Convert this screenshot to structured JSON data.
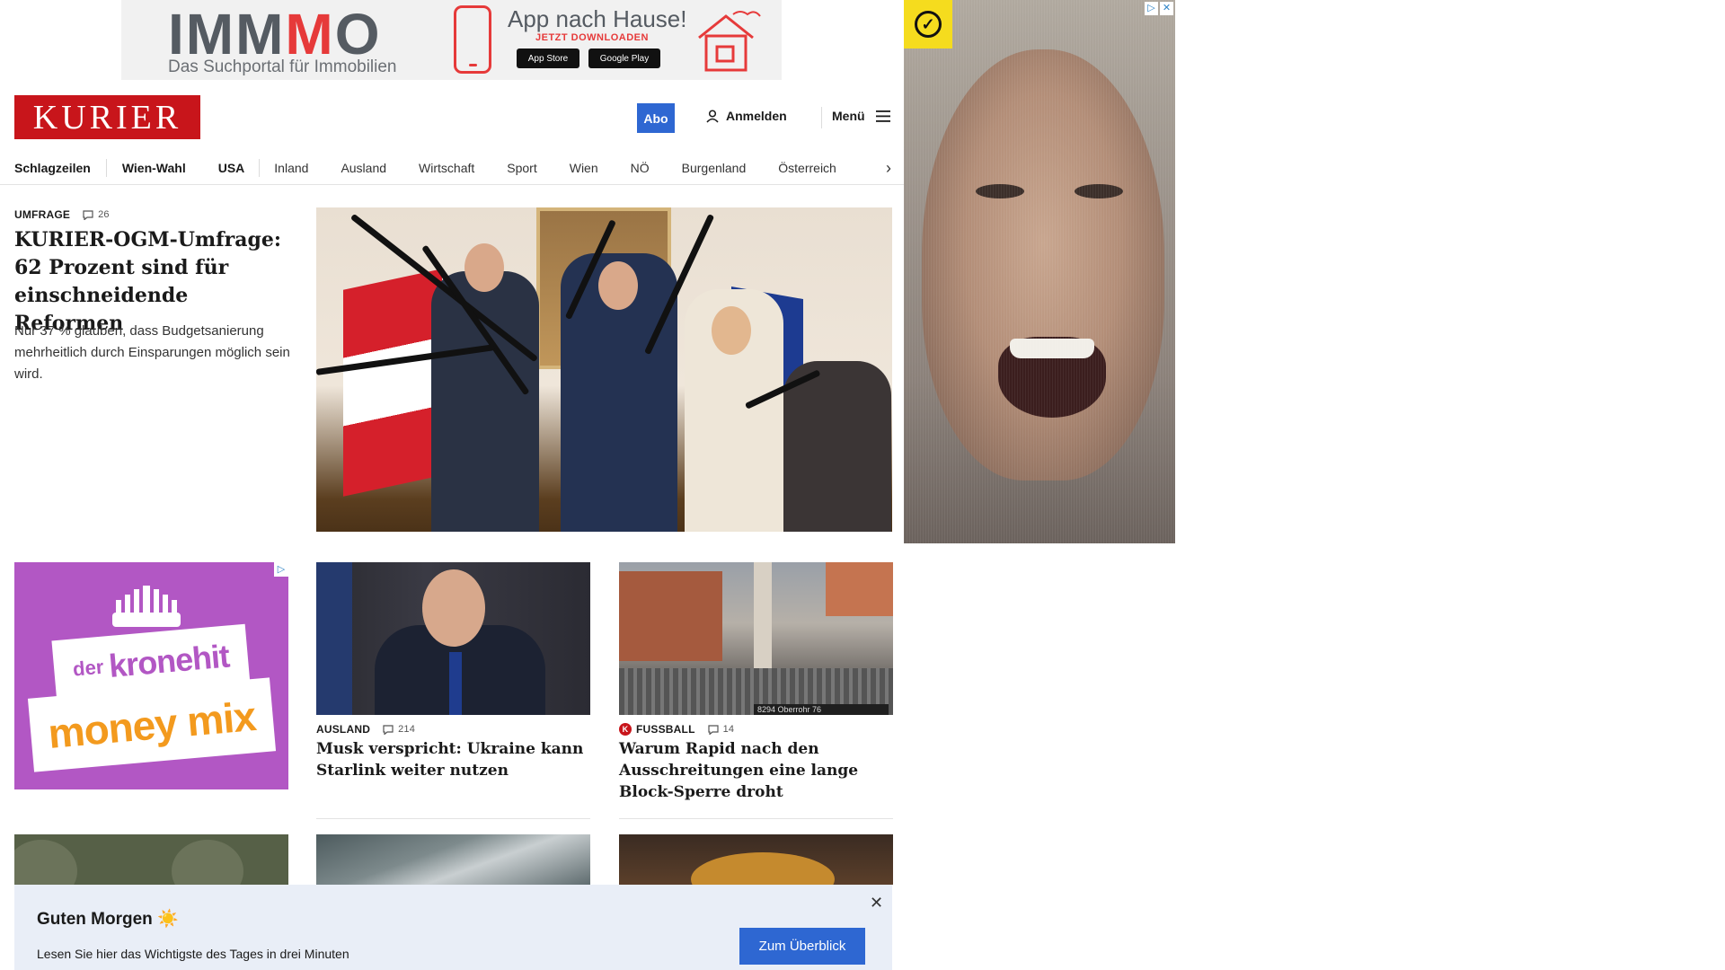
{
  "top_ad": {
    "logo_a": "IMM",
    "logo_red": "M",
    "logo_b": "O",
    "tagline": "Das Suchportal für Immobilien",
    "headline": "App nach Hause!",
    "sub": "JETZT DOWNLOADEN",
    "app_store": "App Store",
    "google_play": "Google Play"
  },
  "side_ad": {
    "corner_icons": [
      "ad-choices-icon",
      "close-icon"
    ]
  },
  "header": {
    "logo": "KURIER",
    "abo": "Abo",
    "login": "Anmelden",
    "menu": "Menü"
  },
  "nav": {
    "items": [
      "Schlagzeilen",
      "Wien-Wahl",
      "USA",
      "Inland",
      "Ausland",
      "Wirtschaft",
      "Sport",
      "Wien",
      "NÖ",
      "Burgenland",
      "Österreich"
    ]
  },
  "lead": {
    "kicker": "UMFRAGE",
    "comments": "26",
    "title": "KURIER-OGM-Umfrage: 62 Prozent sind für einschneidende Reformen",
    "teaser": "Nur 37 % glauben, dass Budgetsanierung mehrheitlich durch Einsparungen möglich sein wird."
  },
  "kronehit_ad": {
    "der": "der",
    "brand": "kronehit",
    "slogan": "money mix"
  },
  "teasers": [
    {
      "kicker": "AUSLAND",
      "comments": "214",
      "title": "Musk verspricht: Ukraine kann Starlink weiter nutzen"
    },
    {
      "kicker": "FUSSBALL",
      "comments": "14",
      "title": "Warum Rapid nach den Ausschreitungen eine lange Block-Sperre droht",
      "image_sign": "8294 Oberrohr 76"
    }
  ],
  "greeting": {
    "title": "Guten Morgen ☀️",
    "text": "Lesen Sie hier das Wichtigste des Tages in drei Minuten",
    "button": "Zum Überblick"
  },
  "colors": {
    "brand_red": "#c8151b",
    "accent_blue": "#2e67d2",
    "greeting_bg": "#e9eef7",
    "kronehit_purple": "#b257c4",
    "kronehit_orange": "#f39a1e"
  }
}
